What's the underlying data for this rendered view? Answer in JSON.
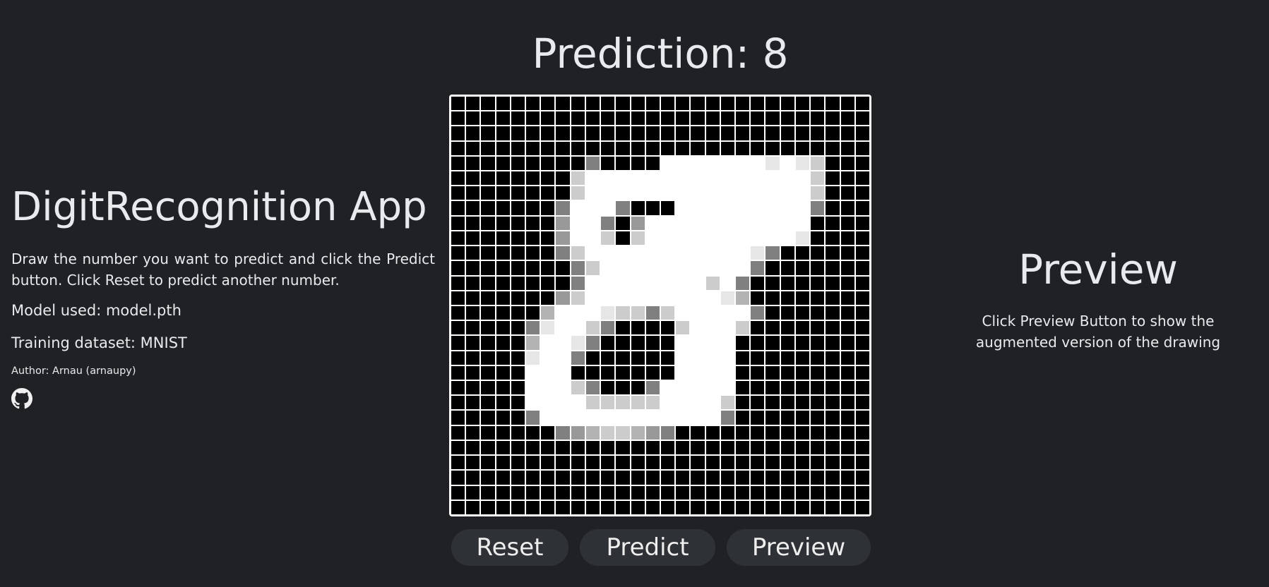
{
  "left_panel": {
    "title": "DigitRecognition App",
    "description": "Draw the number you want to predict and click the Predict button. Click Reset to predict another number.",
    "model_line": "Model used: model.pth",
    "dataset_line": "Training dataset: MNIST",
    "author_line": "Author: Arnau (arnaupy)",
    "github_icon": "github-icon"
  },
  "center": {
    "prediction_text": "Prediction: 8",
    "canvas": {
      "size": 28,
      "pixels": {
        "4": {
          "9": 0.5,
          "14": 1,
          "15": 1,
          "16": 1,
          "17": 1,
          "18": 1,
          "19": 1,
          "20": 1,
          "21": 0.9,
          "22": 1,
          "23": 0.9,
          "24": 0.8
        },
        "5": {
          "8": 0.8,
          "9": 1,
          "10": 1,
          "11": 1,
          "12": 1,
          "13": 1,
          "14": 1,
          "15": 1,
          "16": 1,
          "17": 1,
          "18": 1,
          "19": 1,
          "20": 1,
          "21": 1,
          "22": 1,
          "23": 1,
          "24": 0.8
        },
        "6": {
          "8": 0.8,
          "9": 1,
          "10": 1,
          "11": 1,
          "12": 1,
          "13": 1,
          "14": 1,
          "15": 1,
          "16": 1,
          "17": 1,
          "18": 1,
          "19": 1,
          "20": 1,
          "21": 1,
          "22": 1,
          "23": 1,
          "24": 0.8
        },
        "7": {
          "7": 0.5,
          "8": 1,
          "9": 1,
          "10": 1,
          "11": 0.5,
          "15": 1,
          "16": 1,
          "17": 1,
          "18": 1,
          "19": 1,
          "20": 1,
          "21": 1,
          "22": 1,
          "23": 1,
          "24": 0.5
        },
        "8": {
          "7": 0.6,
          "8": 1,
          "9": 1,
          "10": 0.5,
          "12": 0.6,
          "13": 1,
          "14": 1,
          "15": 1,
          "16": 1,
          "17": 1,
          "18": 1,
          "19": 1,
          "20": 1,
          "21": 1,
          "22": 1,
          "23": 1
        },
        "9": {
          "7": 0.6,
          "8": 1,
          "9": 1,
          "10": 0.8,
          "12": 0.8,
          "13": 1,
          "14": 1,
          "15": 1,
          "16": 1,
          "17": 1,
          "18": 1,
          "19": 1,
          "20": 1,
          "21": 1,
          "22": 1,
          "23": 0.9
        },
        "10": {
          "7": 0.5,
          "8": 0.8,
          "9": 1,
          "10": 1,
          "11": 1,
          "12": 1,
          "13": 1,
          "14": 1,
          "15": 1,
          "16": 1,
          "17": 1,
          "18": 1,
          "19": 1,
          "20": 0.9,
          "21": 0.5
        },
        "11": {
          "8": 0.5,
          "9": 0.8,
          "10": 1,
          "11": 1,
          "12": 1,
          "13": 1,
          "14": 1,
          "15": 1,
          "16": 1,
          "17": 1,
          "18": 1,
          "19": 1,
          "20": 0.5
        },
        "12": {
          "8": 0.5,
          "9": 1,
          "10": 1,
          "11": 1,
          "12": 1,
          "13": 1,
          "14": 1,
          "15": 1,
          "16": 1,
          "17": 0.8,
          "18": 1,
          "19": 0.5
        },
        "13": {
          "7": 0.6,
          "8": 0.8,
          "9": 1,
          "10": 1,
          "11": 1,
          "12": 1,
          "13": 1,
          "14": 1,
          "15": 1,
          "16": 1,
          "17": 1,
          "18": 0.9,
          "19": 0.7
        },
        "14": {
          "6": 0.7,
          "7": 1,
          "8": 1,
          "9": 1,
          "10": 0.9,
          "11": 0.8,
          "12": 0.8,
          "13": 0.5,
          "14": 0.8,
          "15": 1,
          "16": 1,
          "17": 1,
          "18": 1,
          "19": 1,
          "20": 0.5
        },
        "15": {
          "5": 0.5,
          "6": 0.9,
          "7": 1,
          "8": 1,
          "9": 0.8,
          "10": 0.5,
          "15": 0.8,
          "16": 1,
          "17": 1,
          "18": 1,
          "19": 0.8
        },
        "16": {
          "5": 0.7,
          "6": 1,
          "7": 1,
          "8": 0.9,
          "9": 0.5,
          "15": 1,
          "16": 1,
          "17": 1,
          "18": 1
        },
        "17": {
          "5": 0.9,
          "6": 1,
          "7": 1,
          "8": 0.5,
          "15": 1,
          "16": 1,
          "17": 1,
          "18": 1
        },
        "18": {
          "5": 1,
          "6": 1,
          "7": 1,
          "15": 1,
          "16": 1,
          "17": 1,
          "18": 1
        },
        "19": {
          "5": 1,
          "6": 1,
          "7": 1,
          "8": 0.8,
          "9": 0.5,
          "13": 0.5,
          "14": 1,
          "15": 1,
          "16": 1,
          "17": 1,
          "18": 1
        },
        "20": {
          "5": 1,
          "6": 1,
          "7": 1,
          "8": 1,
          "9": 0.8,
          "10": 0.8,
          "11": 0.8,
          "12": 0.8,
          "13": 0.8,
          "14": 1,
          "15": 1,
          "16": 1,
          "17": 1,
          "18": 0.8
        },
        "21": {
          "5": 0.5,
          "6": 1,
          "7": 1,
          "8": 1,
          "9": 1,
          "10": 1,
          "11": 1,
          "12": 1,
          "13": 1,
          "14": 1,
          "15": 1,
          "16": 1,
          "17": 1,
          "18": 0.5
        },
        "22": {
          "7": 0.5,
          "8": 0.6,
          "9": 0.7,
          "10": 0.8,
          "11": 0.8,
          "12": 0.7,
          "13": 0.6,
          "14": 0.5
        }
      }
    }
  },
  "buttons": {
    "reset_label": "Reset",
    "predict_label": "Predict",
    "preview_label": "Preview"
  },
  "right_panel": {
    "title": "Preview",
    "description": "Click Preview Button to show the augmented version of the drawing"
  }
}
